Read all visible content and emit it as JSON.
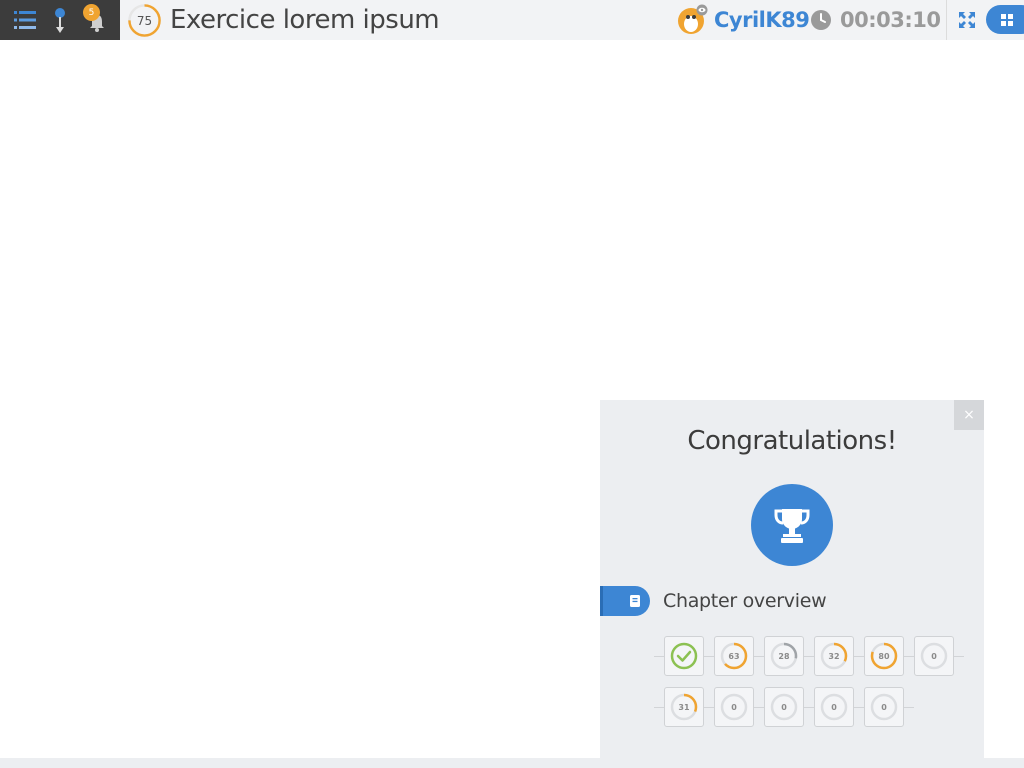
{
  "topbar": {
    "notification_count": "5",
    "score": 75,
    "score_label": "75",
    "title": "Exercice lorem ipsum",
    "username": "CyrilK89",
    "timer": "00:03:10",
    "icons": [
      "menu-icon",
      "pin-icon",
      "bell-icon",
      "avatar",
      "clock-icon",
      "expand-icon",
      "apps-icon"
    ]
  },
  "popup": {
    "close_label": "×",
    "heading": "Congratulations!",
    "trophy_icon": "trophy-icon",
    "chapter_icon": "book-icon",
    "chapter_title": "Chapter overview",
    "exercises": [
      {
        "completed": true,
        "value": null,
        "label": ""
      },
      {
        "completed": false,
        "value": 63,
        "label": "63",
        "color": "#f0a431"
      },
      {
        "completed": false,
        "value": 28,
        "label": "28",
        "color": "#a0a4a8"
      },
      {
        "completed": false,
        "value": 32,
        "label": "32",
        "color": "#f0a431"
      },
      {
        "completed": false,
        "value": 80,
        "label": "80",
        "color": "#f0a431"
      },
      {
        "completed": false,
        "value": 0,
        "label": "0",
        "color": "#a0a4a8"
      },
      {
        "completed": false,
        "value": 31,
        "label": "31",
        "color": "#f0a431"
      },
      {
        "completed": false,
        "value": 0,
        "label": "0",
        "color": "#a0a4a8"
      },
      {
        "completed": false,
        "value": 0,
        "label": "0",
        "color": "#a0a4a8"
      },
      {
        "completed": false,
        "value": 0,
        "label": "0",
        "color": "#a0a4a8"
      },
      {
        "completed": false,
        "value": 0,
        "label": "0",
        "color": "#a0a4a8"
      }
    ]
  },
  "colors": {
    "accent": "#3d86d4",
    "orange": "#f0a431",
    "success": "#8cc152",
    "dark_bar": "#3c3c3c"
  }
}
